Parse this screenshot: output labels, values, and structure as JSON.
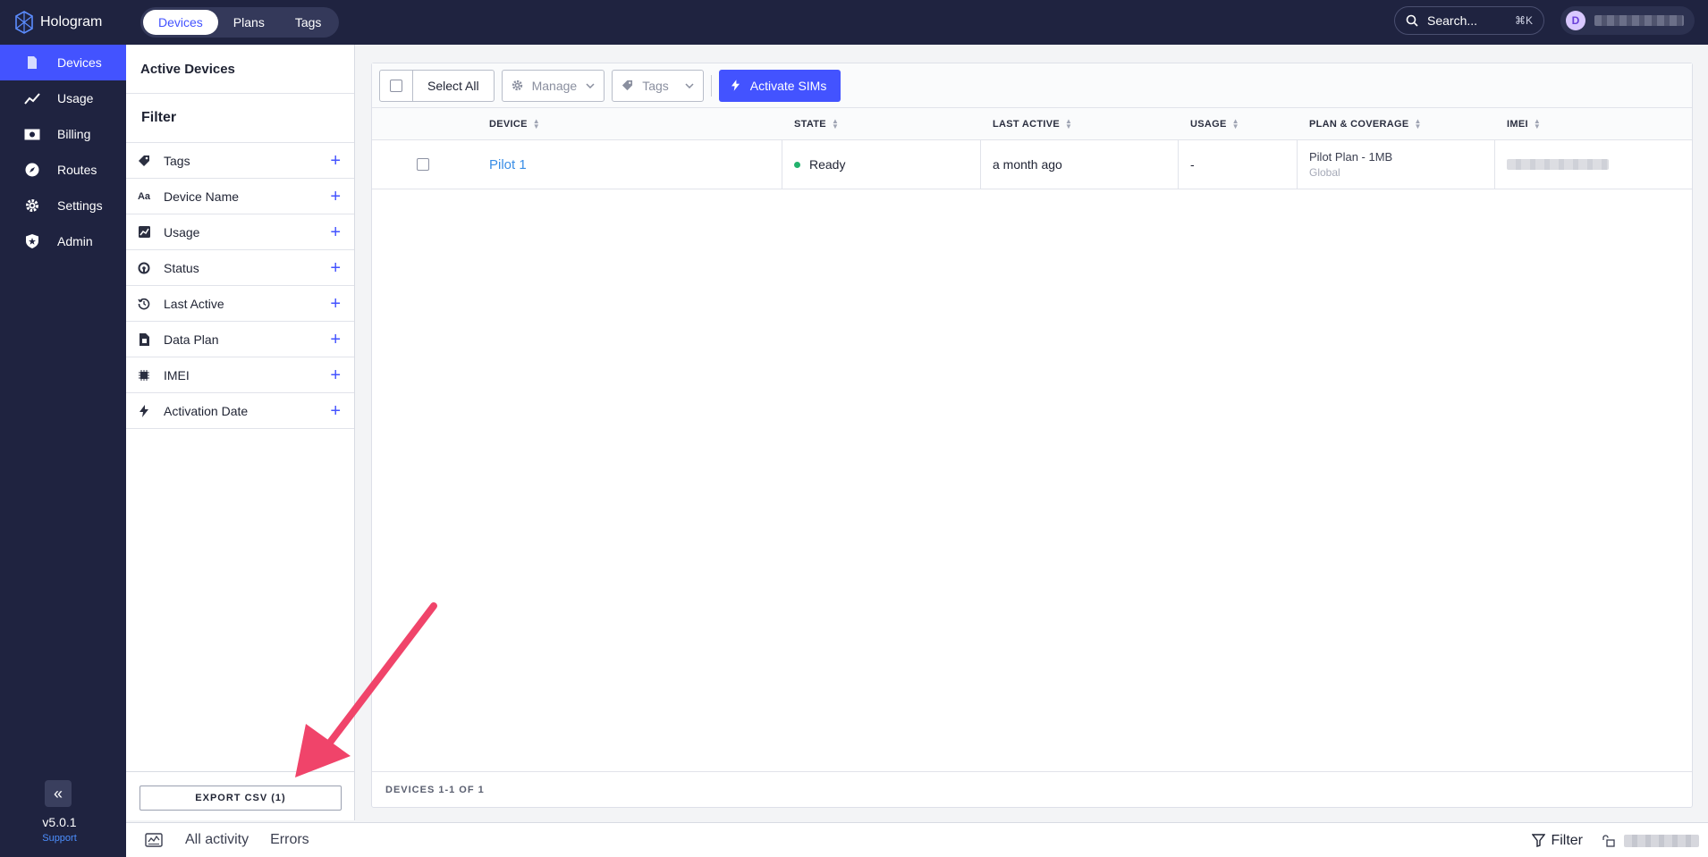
{
  "app": {
    "name": "Hologram",
    "version": "v5.0.1",
    "support_label": "Support"
  },
  "topnav": {
    "tabs": [
      {
        "label": "Devices",
        "active": true
      },
      {
        "label": "Plans",
        "active": false
      },
      {
        "label": "Tags",
        "active": false
      }
    ],
    "search_placeholder": "Search...",
    "search_shortcut": "⌘K",
    "user_initial": "D"
  },
  "sidebar": {
    "items": [
      {
        "label": "Devices",
        "icon": "device-icon",
        "active": true
      },
      {
        "label": "Usage",
        "icon": "chart-icon",
        "active": false
      },
      {
        "label": "Billing",
        "icon": "billing-icon",
        "active": false
      },
      {
        "label": "Routes",
        "icon": "routes-icon",
        "active": false
      },
      {
        "label": "Settings",
        "icon": "gear-icon",
        "active": false
      },
      {
        "label": "Admin",
        "icon": "shield-icon",
        "active": false
      }
    ]
  },
  "filter_panel": {
    "title": "Active Devices",
    "filter_heading": "Filter",
    "filters": [
      {
        "label": "Tags",
        "icon": "tag-icon"
      },
      {
        "label": "Device Name",
        "icon": "text-icon"
      },
      {
        "label": "Usage",
        "icon": "chart-icon"
      },
      {
        "label": "Status",
        "icon": "status-icon"
      },
      {
        "label": "Last Active",
        "icon": "history-icon"
      },
      {
        "label": "Data Plan",
        "icon": "sim-icon"
      },
      {
        "label": "IMEI",
        "icon": "chip-icon"
      },
      {
        "label": "Activation Date",
        "icon": "bolt-icon"
      }
    ],
    "export_label": "EXPORT CSV (1)"
  },
  "toolbar": {
    "select_all_label": "Select All",
    "manage_label": "Manage",
    "tags_label": "Tags",
    "activate_label": "Activate SIMs"
  },
  "table": {
    "columns": [
      "DEVICE",
      "STATE",
      "LAST ACTIVE",
      "USAGE",
      "PLAN & COVERAGE",
      "IMEI"
    ],
    "rows": [
      {
        "device": "Pilot 1",
        "state": "Ready",
        "last_active": "a month ago",
        "usage": "-",
        "plan": "Pilot Plan - 1MB",
        "coverage": "Global"
      }
    ],
    "count_label": "DEVICES 1-1 OF 1"
  },
  "bottombar": {
    "tabs": [
      "All activity",
      "Errors"
    ],
    "filter_label": "Filter"
  },
  "colors": {
    "nav_bg": "#1f2340",
    "accent": "#4353ff",
    "ready": "#23b26d",
    "arrow": "#f0446a"
  }
}
